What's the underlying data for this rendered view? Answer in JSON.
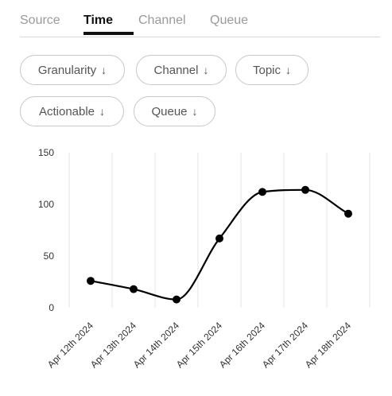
{
  "tabs": [
    {
      "label": "Source"
    },
    {
      "label": "Time"
    },
    {
      "label": "Channel"
    },
    {
      "label": "Queue"
    }
  ],
  "active_tab": "Time",
  "filters": [
    {
      "label": "Granularity",
      "icon": "arrow-down-icon"
    },
    {
      "label": "Channel",
      "icon": "arrow-down-icon"
    },
    {
      "label": "Topic",
      "icon": "arrow-down-icon"
    },
    {
      "label": "Actionable",
      "icon": "arrow-down-icon"
    },
    {
      "label": "Queue",
      "icon": "arrow-down-icon"
    }
  ],
  "arrow_glyph": "↓",
  "chart_data": {
    "type": "line",
    "categories": [
      "Apr 12th 2024",
      "Apr 13th 2024",
      "Apr 14th 2024",
      "Apr 15th 2024",
      "Apr 16th 2024",
      "Apr 17th 2024",
      "Apr 18th 2024"
    ],
    "series": [
      {
        "values": [
          26,
          18,
          8,
          67,
          112,
          114,
          91
        ]
      }
    ],
    "ylim": [
      0,
      150
    ],
    "yticks": [
      0,
      50,
      100,
      150
    ],
    "grid": "vertical",
    "smooth": true,
    "color": "#000000"
  }
}
